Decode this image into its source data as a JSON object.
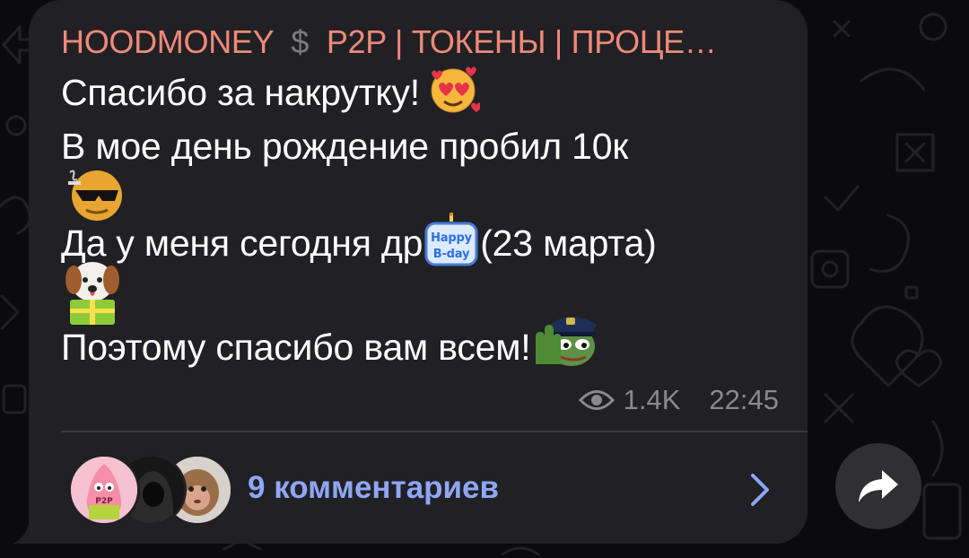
{
  "post": {
    "channel_name": "HOODMONEY",
    "channel_separator_icon": "dollar-icon",
    "channel_name_rest": "P2P | ТОКЕНЫ | ПРОЦЕ…",
    "lines": [
      "Спасибо за накрутку!",
      "В мое день рождение пробил 10к",
      "Да у меня сегодня др",
      "(23 марта)",
      "Поэтому спасибо вам всем!"
    ],
    "emojis": [
      "smiling-face-with-hearts-emoji",
      "cool-smoking-face-emoji",
      "happy-bday-cake-emoji",
      "puppy-gift-emoji",
      "pepe-police-wave-emoji"
    ],
    "views": "1.4K",
    "time": "22:45"
  },
  "comments": {
    "label": "9 комментариев",
    "avatar_badge": "P2P"
  },
  "colors": {
    "bubble": "#212024",
    "channel_name": "#ee8a78",
    "link": "#8ea6f5",
    "meta": "#8a898e"
  }
}
